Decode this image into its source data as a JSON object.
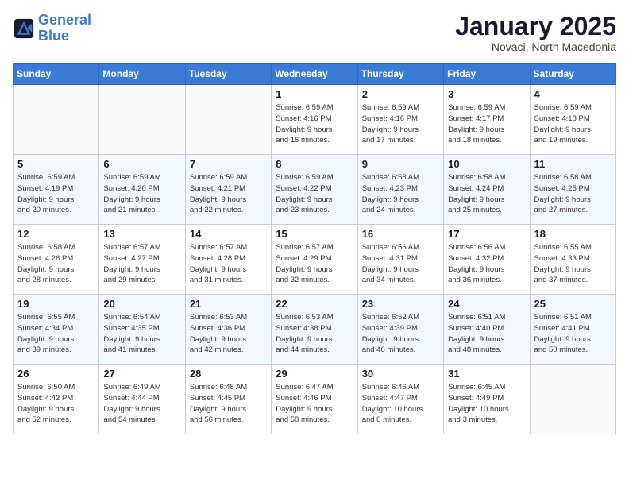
{
  "header": {
    "logo_line1": "General",
    "logo_line2": "Blue",
    "month_year": "January 2025",
    "location": "Novaci, North Macedonia"
  },
  "days_of_week": [
    "Sunday",
    "Monday",
    "Tuesday",
    "Wednesday",
    "Thursday",
    "Friday",
    "Saturday"
  ],
  "weeks": [
    [
      {
        "day": "",
        "info": ""
      },
      {
        "day": "",
        "info": ""
      },
      {
        "day": "",
        "info": ""
      },
      {
        "day": "1",
        "info": "Sunrise: 6:59 AM\nSunset: 4:16 PM\nDaylight: 9 hours\nand 16 minutes."
      },
      {
        "day": "2",
        "info": "Sunrise: 6:59 AM\nSunset: 4:16 PM\nDaylight: 9 hours\nand 17 minutes."
      },
      {
        "day": "3",
        "info": "Sunrise: 6:59 AM\nSunset: 4:17 PM\nDaylight: 9 hours\nand 18 minutes."
      },
      {
        "day": "4",
        "info": "Sunrise: 6:59 AM\nSunset: 4:18 PM\nDaylight: 9 hours\nand 19 minutes."
      }
    ],
    [
      {
        "day": "5",
        "info": "Sunrise: 6:59 AM\nSunset: 4:19 PM\nDaylight: 9 hours\nand 20 minutes."
      },
      {
        "day": "6",
        "info": "Sunrise: 6:59 AM\nSunset: 4:20 PM\nDaylight: 9 hours\nand 21 minutes."
      },
      {
        "day": "7",
        "info": "Sunrise: 6:59 AM\nSunset: 4:21 PM\nDaylight: 9 hours\nand 22 minutes."
      },
      {
        "day": "8",
        "info": "Sunrise: 6:59 AM\nSunset: 4:22 PM\nDaylight: 9 hours\nand 23 minutes."
      },
      {
        "day": "9",
        "info": "Sunrise: 6:58 AM\nSunset: 4:23 PM\nDaylight: 9 hours\nand 24 minutes."
      },
      {
        "day": "10",
        "info": "Sunrise: 6:58 AM\nSunset: 4:24 PM\nDaylight: 9 hours\nand 25 minutes."
      },
      {
        "day": "11",
        "info": "Sunrise: 6:58 AM\nSunset: 4:25 PM\nDaylight: 9 hours\nand 27 minutes."
      }
    ],
    [
      {
        "day": "12",
        "info": "Sunrise: 6:58 AM\nSunset: 4:26 PM\nDaylight: 9 hours\nand 28 minutes."
      },
      {
        "day": "13",
        "info": "Sunrise: 6:57 AM\nSunset: 4:27 PM\nDaylight: 9 hours\nand 29 minutes."
      },
      {
        "day": "14",
        "info": "Sunrise: 6:57 AM\nSunset: 4:28 PM\nDaylight: 9 hours\nand 31 minutes."
      },
      {
        "day": "15",
        "info": "Sunrise: 6:57 AM\nSunset: 4:29 PM\nDaylight: 9 hours\nand 32 minutes."
      },
      {
        "day": "16",
        "info": "Sunrise: 6:56 AM\nSunset: 4:31 PM\nDaylight: 9 hours\nand 34 minutes."
      },
      {
        "day": "17",
        "info": "Sunrise: 6:56 AM\nSunset: 4:32 PM\nDaylight: 9 hours\nand 36 minutes."
      },
      {
        "day": "18",
        "info": "Sunrise: 6:55 AM\nSunset: 4:33 PM\nDaylight: 9 hours\nand 37 minutes."
      }
    ],
    [
      {
        "day": "19",
        "info": "Sunrise: 6:55 AM\nSunset: 4:34 PM\nDaylight: 9 hours\nand 39 minutes."
      },
      {
        "day": "20",
        "info": "Sunrise: 6:54 AM\nSunset: 4:35 PM\nDaylight: 9 hours\nand 41 minutes."
      },
      {
        "day": "21",
        "info": "Sunrise: 6:53 AM\nSunset: 4:36 PM\nDaylight: 9 hours\nand 42 minutes."
      },
      {
        "day": "22",
        "info": "Sunrise: 6:53 AM\nSunset: 4:38 PM\nDaylight: 9 hours\nand 44 minutes."
      },
      {
        "day": "23",
        "info": "Sunrise: 6:52 AM\nSunset: 4:39 PM\nDaylight: 9 hours\nand 46 minutes."
      },
      {
        "day": "24",
        "info": "Sunrise: 6:51 AM\nSunset: 4:40 PM\nDaylight: 9 hours\nand 48 minutes."
      },
      {
        "day": "25",
        "info": "Sunrise: 6:51 AM\nSunset: 4:41 PM\nDaylight: 9 hours\nand 50 minutes."
      }
    ],
    [
      {
        "day": "26",
        "info": "Sunrise: 6:50 AM\nSunset: 4:42 PM\nDaylight: 9 hours\nand 52 minutes."
      },
      {
        "day": "27",
        "info": "Sunrise: 6:49 AM\nSunset: 4:44 PM\nDaylight: 9 hours\nand 54 minutes."
      },
      {
        "day": "28",
        "info": "Sunrise: 6:48 AM\nSunset: 4:45 PM\nDaylight: 9 hours\nand 56 minutes."
      },
      {
        "day": "29",
        "info": "Sunrise: 6:47 AM\nSunset: 4:46 PM\nDaylight: 9 hours\nand 58 minutes."
      },
      {
        "day": "30",
        "info": "Sunrise: 6:46 AM\nSunset: 4:47 PM\nDaylight: 10 hours\nand 0 minutes."
      },
      {
        "day": "31",
        "info": "Sunrise: 6:45 AM\nSunset: 4:49 PM\nDaylight: 10 hours\nand 3 minutes."
      },
      {
        "day": "",
        "info": ""
      }
    ]
  ]
}
